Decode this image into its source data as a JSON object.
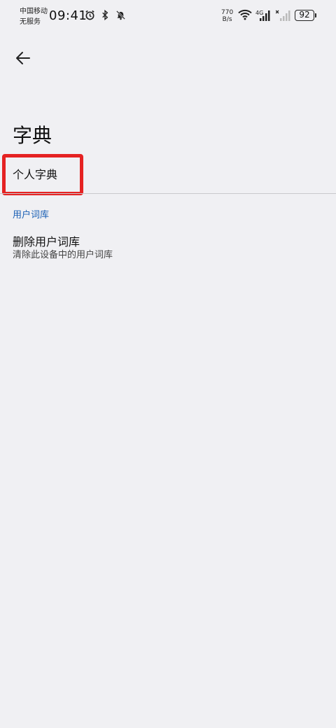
{
  "status_bar": {
    "carrier_line1": "中国移动",
    "carrier_line2": "无服务",
    "time": "09:41",
    "net_speed_value": "770",
    "net_speed_unit": "B/s",
    "network_type": "4G",
    "battery": "92"
  },
  "header": {
    "title": "字典"
  },
  "personal_dictionary": {
    "label": "个人字典"
  },
  "user_dictionary_section": {
    "header": "用户词库",
    "delete_item": {
      "title": "删除用户词库",
      "summary": "清除此设备中的用户词库"
    }
  },
  "colors": {
    "background": "#f0f0f3",
    "accent": "#1a5fb4",
    "highlight": "#e52222"
  }
}
